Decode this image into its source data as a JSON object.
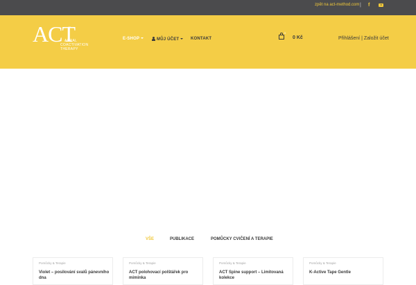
{
  "topbar": {
    "back_link": "zpět na act-method.com",
    "divider": "|",
    "facebook_glyph": "f",
    "icons": [
      "facebook-icon",
      "youtube-icon"
    ]
  },
  "colors": {
    "header_yellow": "#f4cd46",
    "topbar_gray": "#4b4b4d",
    "accent": "#f0c83a",
    "text_dark": "#3a3a3a"
  },
  "logo": {
    "mark": "ACT",
    "tm": "™",
    "line1": "ACRAL",
    "line2": "COACTIVATION",
    "line3": "THERAPY"
  },
  "nav": {
    "eshop": "E-SHOP",
    "account": "MŮJ ÚČET",
    "contact": "KONTAKT"
  },
  "cart": {
    "count": "0",
    "total": "0 Kč"
  },
  "auth": {
    "login": "Přihlášení",
    "separator": "|",
    "register": "Založit účet"
  },
  "filters": {
    "all": "VŠE",
    "publications": "PUBLIKACE",
    "aids": "POMŮCKY CVIČENÍ A TERAPIE"
  },
  "products": [
    {
      "category": "Pomůcky & Terapie",
      "title": "Violet – posilování svalů pánevního dna"
    },
    {
      "category": "Pomůcky & Terapie",
      "title": "ACT polohovací polštářek pro miminka"
    },
    {
      "category": "Pomůcky & Terapie",
      "title": "ACT Spine support – Limitovaná kolekce"
    },
    {
      "category": "Pomůcky & Terapie",
      "title": "K-Active Tape Gentle"
    }
  ]
}
